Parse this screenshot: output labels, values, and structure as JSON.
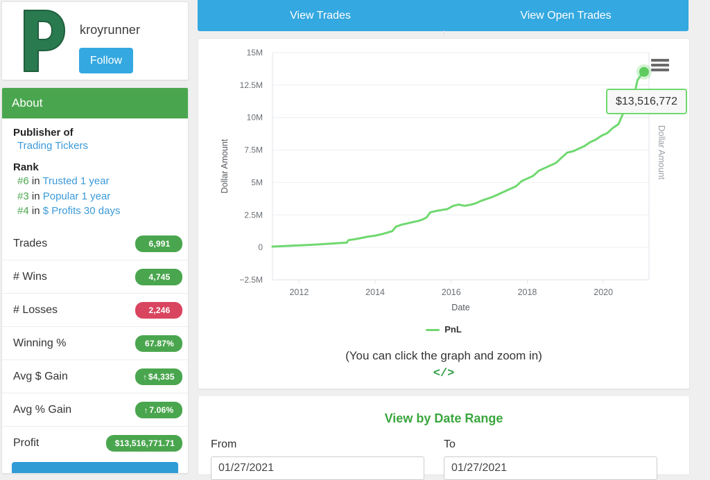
{
  "profile": {
    "logo_icon": "letter-p-logo",
    "username": "kroyrunner",
    "follow_label": "Follow"
  },
  "about": {
    "header": "About",
    "publisher_title": "Publisher of",
    "publisher_name": "Trading Tickers",
    "rank_title": "Rank",
    "ranks": [
      {
        "num": "#6",
        "in": "in",
        "label": "Trusted 1 year"
      },
      {
        "num": "#3",
        "in": "in",
        "label": "Popular 1 year"
      },
      {
        "num": "#4",
        "in": "in",
        "label": "$ Profits 30 days"
      }
    ],
    "stats": [
      {
        "label": "Trades",
        "value": "6,991",
        "color": "green",
        "arrow": ""
      },
      {
        "label": "# Wins",
        "value": "4,745",
        "color": "green",
        "arrow": ""
      },
      {
        "label": "# Losses",
        "value": "2,246",
        "color": "red",
        "arrow": ""
      },
      {
        "label": "Winning %",
        "value": "67.87%",
        "color": "green",
        "arrow": ""
      },
      {
        "label": "Avg $ Gain",
        "value": "$4,335",
        "color": "green",
        "arrow": "↑"
      },
      {
        "label": "Avg % Gain",
        "value": "7.06%",
        "color": "green",
        "arrow": "↑"
      },
      {
        "label": "Profit",
        "value": "$13,516,771.71",
        "color": "green",
        "arrow": ""
      }
    ]
  },
  "tabs": [
    {
      "label": "View Trades"
    },
    {
      "label": "View Open Trades"
    }
  ],
  "chart_panel": {
    "menu_icon": "hamburger-menu-icon",
    "tooltip_value": "$13,516,772",
    "caption": "(You can click the graph and zoom in)",
    "code_icon": "</>"
  },
  "date_range": {
    "title": "View by Date Range",
    "from_label": "From",
    "to_label": "To",
    "from_value": "01/27/2021",
    "to_value": "01/27/2021"
  },
  "colors": {
    "brand_green": "#4aa64e",
    "brand_blue": "#34a8e0",
    "line_green": "#6fd86f",
    "badge_red": "#d9455f",
    "link_blue": "#3a9ad9"
  },
  "chart_data": {
    "type": "line",
    "title": "",
    "xlabel": "Date",
    "ylabel": "Dollar Amount",
    "ylabel_right": "Dollar Amount",
    "legend": [
      "PnL"
    ],
    "legend_position": "bottom",
    "grid": true,
    "ylim": [
      -2500000,
      15000000
    ],
    "yticks": [
      -2500000,
      0,
      2500000,
      5000000,
      7500000,
      10000000,
      12500000,
      15000000
    ],
    "ytick_labels": [
      "−2.5M",
      "0",
      "2.5M",
      "5M",
      "7.5M",
      "10M",
      "12.5M",
      "15M"
    ],
    "xlim": [
      2011.3,
      2021.2
    ],
    "xticks": [
      2012,
      2014,
      2016,
      2018,
      2020
    ],
    "xtick_labels": [
      "2012",
      "2014",
      "2016",
      "2018",
      "2020"
    ],
    "annotation": {
      "label": "$13,516,772",
      "x": 2021.07,
      "y": 13516772
    },
    "series": [
      {
        "name": "PnL",
        "color": "#6fd86f",
        "x": [
          2011.3,
          2011.6,
          2011.9,
          2012.2,
          2012.5,
          2012.8,
          2013.0,
          2013.1,
          2013.25,
          2013.3,
          2013.45,
          2013.6,
          2013.8,
          2014.0,
          2014.15,
          2014.3,
          2014.45,
          2014.55,
          2014.7,
          2014.85,
          2015.0,
          2015.15,
          2015.25,
          2015.35,
          2015.45,
          2015.6,
          2015.75,
          2015.9,
          2016.05,
          2016.2,
          2016.35,
          2016.5,
          2016.65,
          2016.8,
          2016.95,
          2017.1,
          2017.25,
          2017.4,
          2017.55,
          2017.7,
          2017.85,
          2018.0,
          2018.15,
          2018.3,
          2018.45,
          2018.6,
          2018.75,
          2018.9,
          2019.05,
          2019.2,
          2019.35,
          2019.5,
          2019.65,
          2019.8,
          2019.95,
          2020.1,
          2020.25,
          2020.4,
          2020.5,
          2020.6,
          2020.7,
          2020.8,
          2020.9,
          2021.0,
          2021.07
        ],
        "y": [
          60000,
          100000,
          140000,
          180000,
          230000,
          280000,
          320000,
          340000,
          360000,
          560000,
          620000,
          700000,
          820000,
          900000,
          1000000,
          1120000,
          1250000,
          1600000,
          1750000,
          1850000,
          1950000,
          2050000,
          2150000,
          2300000,
          2700000,
          2800000,
          2880000,
          2950000,
          3200000,
          3300000,
          3200000,
          3280000,
          3400000,
          3600000,
          3750000,
          3900000,
          4100000,
          4300000,
          4500000,
          4700000,
          5100000,
          5300000,
          5500000,
          5900000,
          6100000,
          6300000,
          6500000,
          6900000,
          7300000,
          7400000,
          7600000,
          7800000,
          8100000,
          8300000,
          8600000,
          8800000,
          9200000,
          9500000,
          10200000,
          10700000,
          11200000,
          11600000,
          12900000,
          13300000,
          13516772
        ]
      }
    ]
  }
}
